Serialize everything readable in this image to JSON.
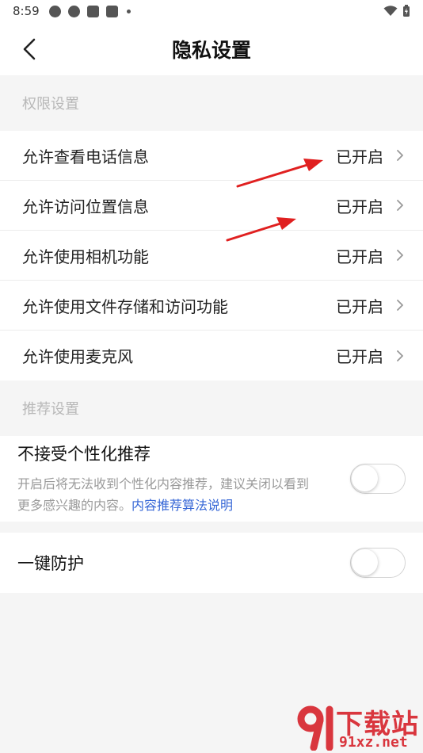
{
  "status_bar": {
    "time": "8:59"
  },
  "header": {
    "title": "隐私设置"
  },
  "permissions": {
    "section_title": "权限设置",
    "items": [
      {
        "label": "允许查看电话信息",
        "value": "已开启"
      },
      {
        "label": "允许访问位置信息",
        "value": "已开启"
      },
      {
        "label": "允许使用相机功能",
        "value": "已开启"
      },
      {
        "label": "允许使用文件存储和访问功能",
        "value": "已开启"
      },
      {
        "label": "允许使用麦克风",
        "value": "已开启"
      }
    ]
  },
  "recommendation": {
    "section_title": "推荐设置",
    "title": "不接受个性化推荐",
    "description": "开启后将无法收到个性化内容推荐，建议关闭以看到更多感兴趣的内容。",
    "link": "内容推荐算法说明",
    "enabled": false
  },
  "protection": {
    "label": "一键防护",
    "enabled": false
  },
  "watermark": {
    "text": "下载站",
    "domain": "91xz.net"
  },
  "colors": {
    "accent_link": "#3566d6",
    "arrow": "#e02020",
    "watermark": "#d9363e"
  }
}
